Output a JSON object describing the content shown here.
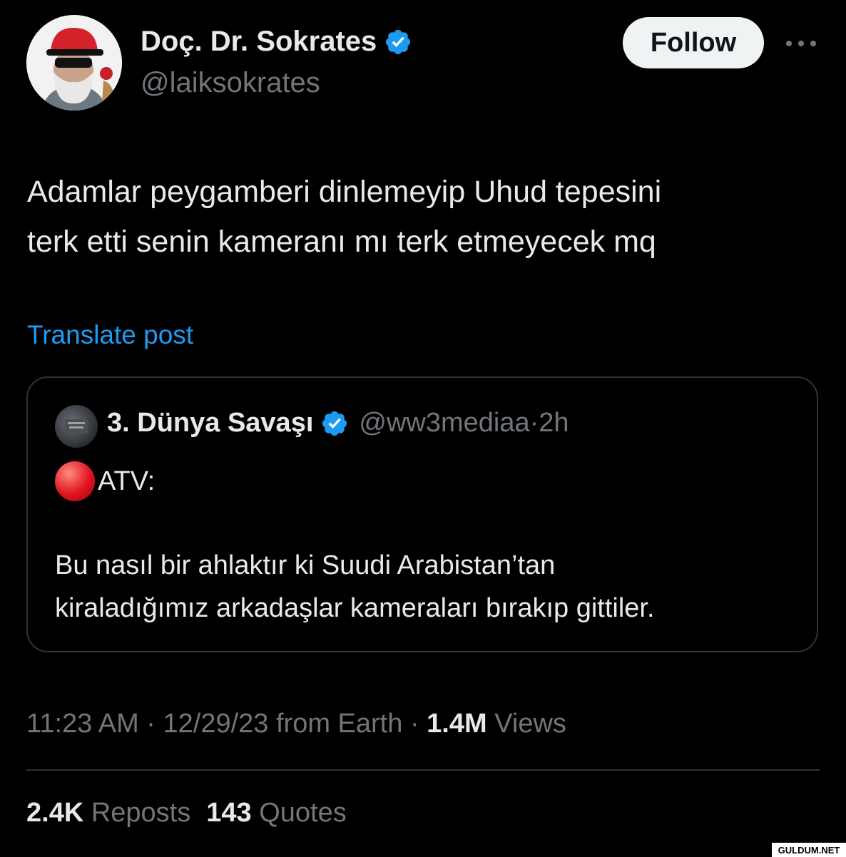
{
  "author": {
    "name": "Doç. Dr. Sokrates",
    "handle": "@laiksokrates"
  },
  "follow_label": "Follow",
  "tweet": {
    "lines": [
      "Adamlar peygamberi dinlemeyip Uhud tepesini",
      "terk etti senin kameranı mı terk etmeyecek mq"
    ]
  },
  "translate_label": "Translate post",
  "quote": {
    "name": "3. Dünya Savaşı",
    "handle": "@ww3mediaa",
    "sep": "·",
    "age": "2h",
    "line1": "ATV:",
    "body": [
      "Bu nasıl bir ahlaktır ki Suudi Arabistan’tan",
      "kiraladığımız arkadaşlar kameraları bırakıp gittiler."
    ]
  },
  "meta": {
    "time": "11:23 AM",
    "sep": " · ",
    "date": "12/29/23",
    "from": " from Earth",
    "views_count": "1.4M",
    "views_label": " Views"
  },
  "stats": {
    "reposts_count": "2.4K",
    "reposts_label": " Reposts",
    "quotes_count": "143",
    "quotes_label": " Quotes"
  },
  "watermark": "GULDUM.NET",
  "colors": {
    "background": "#000000",
    "text": "#e7e9ea",
    "muted": "#71767b",
    "link": "#1d9bf0",
    "verified": "#1d9bf0",
    "live_dot": "#e0141e"
  },
  "icons": [
    "verified-badge-icon",
    "more-options-icon",
    "live-red-dot-icon"
  ]
}
